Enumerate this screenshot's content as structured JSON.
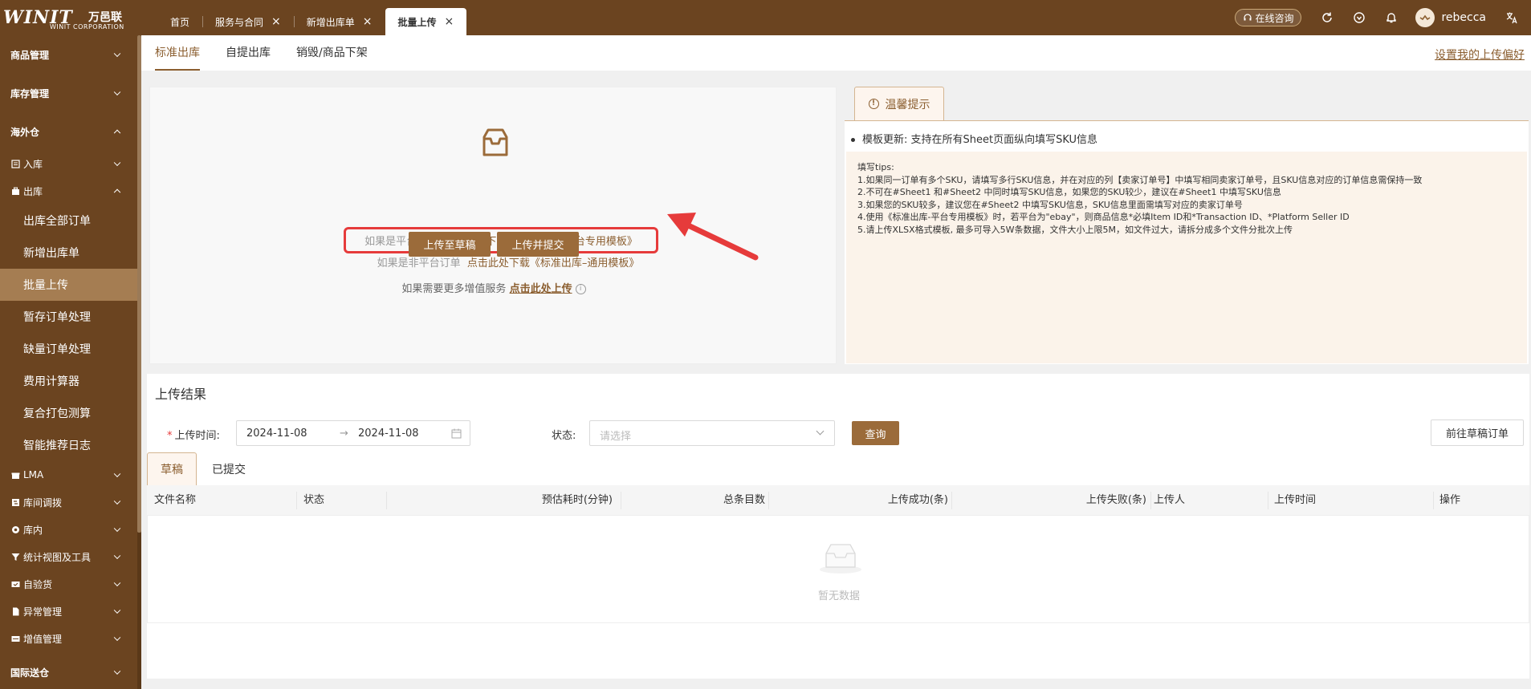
{
  "brand": {
    "mark": "WINIT",
    "cn": "万邑联",
    "en": "WINIT CORPORATION"
  },
  "tabs": [
    {
      "label": "首页"
    },
    {
      "label": "服务与合同",
      "close": "×"
    },
    {
      "label": "新增出库单",
      "close": "×"
    },
    {
      "label": "批量上传",
      "close": "×"
    }
  ],
  "header": {
    "consult_label": "在线咨询",
    "username": "rebecca"
  },
  "sidebar": {
    "groups": {
      "goods": "商品管理",
      "stock": "库存管理",
      "overseas": "海外仓",
      "intl": "国际送仓"
    },
    "subs": {
      "inbound": "入库",
      "outbound": "出库",
      "lma": "LMA",
      "transfer": "库间调拨",
      "inwh": "库内",
      "stats": "统计视图及工具",
      "selfcheck": "自验货",
      "exception": "异常管理",
      "vas": "增值管理"
    },
    "leaves": [
      "出库全部订单",
      "新增出库单",
      "批量上传",
      "暂存订单处理",
      "缺量订单处理",
      "费用计算器",
      "复合打包测算",
      "智能推荐日志"
    ]
  },
  "subtabs": {
    "standard": "标准出库",
    "selfpick": "自提出库",
    "destroy": "销毁/商品下架",
    "pref": "设置我的上传偏好"
  },
  "upload": {
    "platform_prefix": "如果是平台订单",
    "platform_link": "点击此处下载《标准出库–平台专用模板》",
    "nonplatform_prefix": "如果是非平台订单",
    "nonplatform_link": "点击此处下载《标准出库–通用模板》",
    "btn_draft": "上传至草稿",
    "btn_submit": "上传并提交",
    "more_prefix": "如果需要更多增值服务",
    "more_link": "点击此处上传"
  },
  "tips": {
    "tab": "温馨提示",
    "headline": "模板更新: 支持在所有Sheet页面纵向填写SKU信息",
    "title": "填写tips:",
    "lines": [
      "1.如果同一订单有多个SKU，请填写多行SKU信息，并在对应的列【卖家订单号】中填写相同卖家订单号，且SKU信息对应的订单信息需保持一致",
      "2.不可在#Sheet1 和#Sheet2 中同时填写SKU信息，如果您的SKU较少，建议在#Sheet1 中填写SKU信息",
      "3.如果您的SKU较多，建议您在#Sheet2 中填写SKU信息，SKU信息里面需填写对应的卖家订单号",
      "4.使用《标准出库-平台专用模板》时，若平台为\"ebay\"，则商品信息*必填Item ID和*Transaction ID、*Platform Seller ID",
      "5.请上传XLSX格式模板, 最多可导入5W条数据，文件大小上限5M，如文件过大，请拆分成多个文件分批次上传"
    ]
  },
  "results": {
    "title": "上传结果",
    "time_label": "上传时间:",
    "date_start": "2024-11-08",
    "date_end": "2024-11-08",
    "status_label": "状态:",
    "status_placeholder": "请选择",
    "query_btn": "查询",
    "goto_draft_btn": "前往草稿订单",
    "tabs": [
      "草稿",
      "已提交"
    ],
    "columns": [
      "文件名称",
      "状态",
      "预估耗时(分钟)",
      "总条目数",
      "上传成功(条)",
      "上传失败(条)",
      "上传人",
      "上传时间",
      "操作"
    ],
    "empty_text": "暂无数据"
  },
  "colors": {
    "brand_dark": "#6b4420",
    "accent": "#8b5e2f",
    "button": "#9b6b3a",
    "highlight_red": "#e63b3b"
  },
  "icons": [
    "inbox-icon",
    "refresh-icon",
    "shield-icon",
    "bell-icon",
    "translate-icon",
    "headset-icon",
    "info-icon",
    "calendar-icon",
    "chevron-down-icon",
    "empty-box-icon",
    "red-arrow-annotation"
  ]
}
